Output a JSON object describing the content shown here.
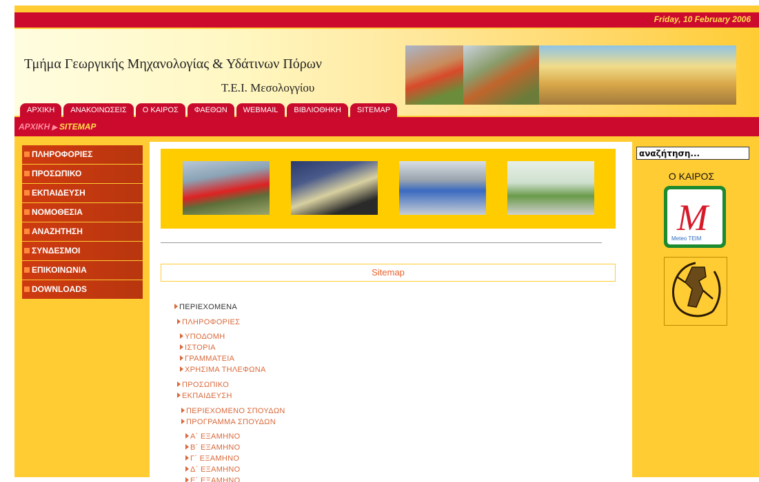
{
  "header": {
    "date": "Friday, 10 February 2006",
    "title_line1": "Τμήμα Γεωργικής Μηχανολογίας & Υδάτινων Πόρων",
    "title_line2": "Τ.Ε.Ι. Μεσολογγίου"
  },
  "tabs": [
    "ΑΡΧΙΚΗ",
    "ΑΝΑΚΟΙΝΩΣΕΙΣ",
    "Ο ΚΑΙΡΟΣ",
    "ΦΑΕΘΩΝ",
    "WEBMAIL",
    "ΒΙΒΛΙΟΘΗΚΗ",
    "SITEMAP"
  ],
  "breadcrumb": {
    "home": "ΑΡΧΙΚΗ",
    "current": "SITEMAP"
  },
  "left_menu": [
    "ΠΛΗΡΟΦΟΡΙΕΣ",
    "ΠΡΟΣΩΠΙΚΟ",
    "ΕΚΠΑΙΔΕΥΣΗ",
    "ΝΟΜΟΘΕΣΙΑ",
    "ΑΝΑΖΗΤΗΣΗ",
    "ΣΥΝΔΕΣΜΟΙ",
    "ΕΠΙΚΟΙΝΩΝΙΑ",
    "DOWNLOADS"
  ],
  "sitemap": {
    "heading": "Sitemap",
    "items": [
      {
        "label": "ΠΕΡΙΕΧΟΜΕΝΑ",
        "level": 0
      },
      {
        "label": "ΠΛΗΡΟΦΟΡΙΕΣ",
        "level": 1
      },
      {
        "label": "ΥΠΟΔΟΜΗ",
        "level": 2
      },
      {
        "label": "ΙΣΤΟΡΙΑ",
        "level": 2
      },
      {
        "label": "ΓΡΑΜΜΑΤΕΙΑ",
        "level": 2
      },
      {
        "label": "ΧΡΗΣΙΜΑ ΤΗΛΕΦΩΝΑ",
        "level": 2
      },
      {
        "label": "ΠΡΟΣΩΠΙΚΟ",
        "level": 1
      },
      {
        "label": "ΕΚΠΑΙΔΕΥΣΗ",
        "level": 1
      },
      {
        "label": "ΠΕΡΙΕΧΟΜΕΝΟ ΣΠΟΥΔΩΝ",
        "level": 2
      },
      {
        "label": "ΠΡΟΓΡΑΜΜΑ ΣΠΟΥΔΩΝ",
        "level": 2
      },
      {
        "label": "Α΄ ΕΞΑΜΗΝΟ",
        "level": 3
      },
      {
        "label": "Β΄ ΕΞΑΜΗΝΟ",
        "level": 3
      },
      {
        "label": "Γ΄ ΕΞΑΜΗΝΟ",
        "level": 3
      },
      {
        "label": "Δ΄ ΕΞΑΜΗΝΟ",
        "level": 3
      },
      {
        "label": "Ε΄ ΕΞΑΜΗΝΟ",
        "level": 3
      }
    ]
  },
  "right": {
    "search_value": "αναζήτηση...",
    "weather_title": "Ο ΚΑΙΡΟΣ",
    "meteo_label": "Meteo TEIM"
  },
  "colors": {
    "accent_red": "#cc0a2e",
    "background_yellow": "#ffcc33",
    "menu_orange": "#cf3a10",
    "link_orange": "#d9683a"
  }
}
